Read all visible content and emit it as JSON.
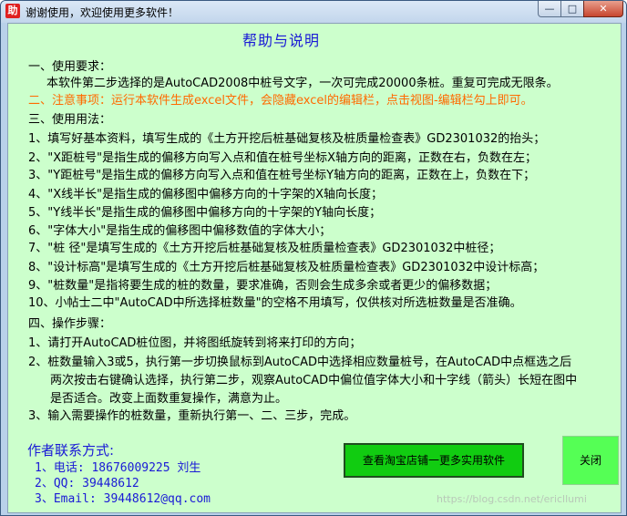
{
  "window": {
    "title": "谢谢使用，欢迎使用更多软件！",
    "icon_glyph": "助",
    "minimize_glyph": "—",
    "maximize_glyph": "□",
    "close_glyph": "✕"
  },
  "help": {
    "heading": "帮助与说明",
    "lines": [
      "一、使用要求：",
      "本软件第二步选择的是AutoCAD2008中桩号文字，一次可完成20000条桩。重复可完成无限条。",
      "二、注意事项：运行本软件生成excel文件，会隐藏excel的编辑栏，点击视图-编辑栏勾上即可。",
      "三、使用用法：",
      "1、填写好基本资料，填写生成的《土方开挖后桩基础复核及桩质量检查表》GD2301032的抬头；",
      "2、\"X距桩号\"是指生成的偏移方向写入点和值在桩号坐标X轴方向的距离，正数在右，负数在左；",
      "3、\"Y距桩号\"是指生成的偏移方向写入点和值在桩号坐标Y轴方向的距离，正数在上，负数在下；",
      "4、\"X线半长\"是指生成的偏移图中偏移方向的十字架的X轴向长度；",
      "5、\"Y线半长\"是指生成的偏移图中偏移方向的十字架的Y轴向长度；",
      "6、\"字体大小\"是指生成的偏移图中偏移数值的字体大小；",
      "7、\"桩    径\"是填写生成的《土方开挖后桩基础复核及桩质量检查表》GD2301032中桩径；",
      "8、\"设计标高\"是填写生成的《土方开挖后桩基础复核及桩质量检查表》GD2301032中设计标高；",
      "9、\"桩数量\"是指将要生成的桩的数量，要求准确，否则会生成多余或者更少的偏移数据；",
      "10、小帖士二中\"AutoCAD中所选择桩数量\"的空格不用填写，仅供核对所选桩数量是否准确。",
      "四、操作步骤：",
      "1、请打开AutoCAD桩位图，并将图纸旋转到将来打印的方向；",
      "2、桩数量输入3或5，执行第一步切换鼠标到AutoCAD中选择相应数量桩号，在AutoCAD中点框选之后",
      "两次按击右键确认选择，执行第二步，观察AutoCAD中偏位值字体大小和十字线（箭头）长短在图中",
      "是否适合。改变上面数重复操作，满意为止。",
      "3、输入需要操作的桩数量，重新执行第一、二、三步，完成。"
    ]
  },
  "contact": {
    "title": "作者联系方式:",
    "phone": "1、电话: 18676009225 刘生",
    "qq": "2、QQ: 39448612",
    "email": "3、Email: 39448612@qq.com"
  },
  "buttons": {
    "taobao": "查看淘宝店铺一更多实用软件",
    "close": "关闭"
  },
  "watermark": "https://blog.csdn.net/ericllumi"
}
